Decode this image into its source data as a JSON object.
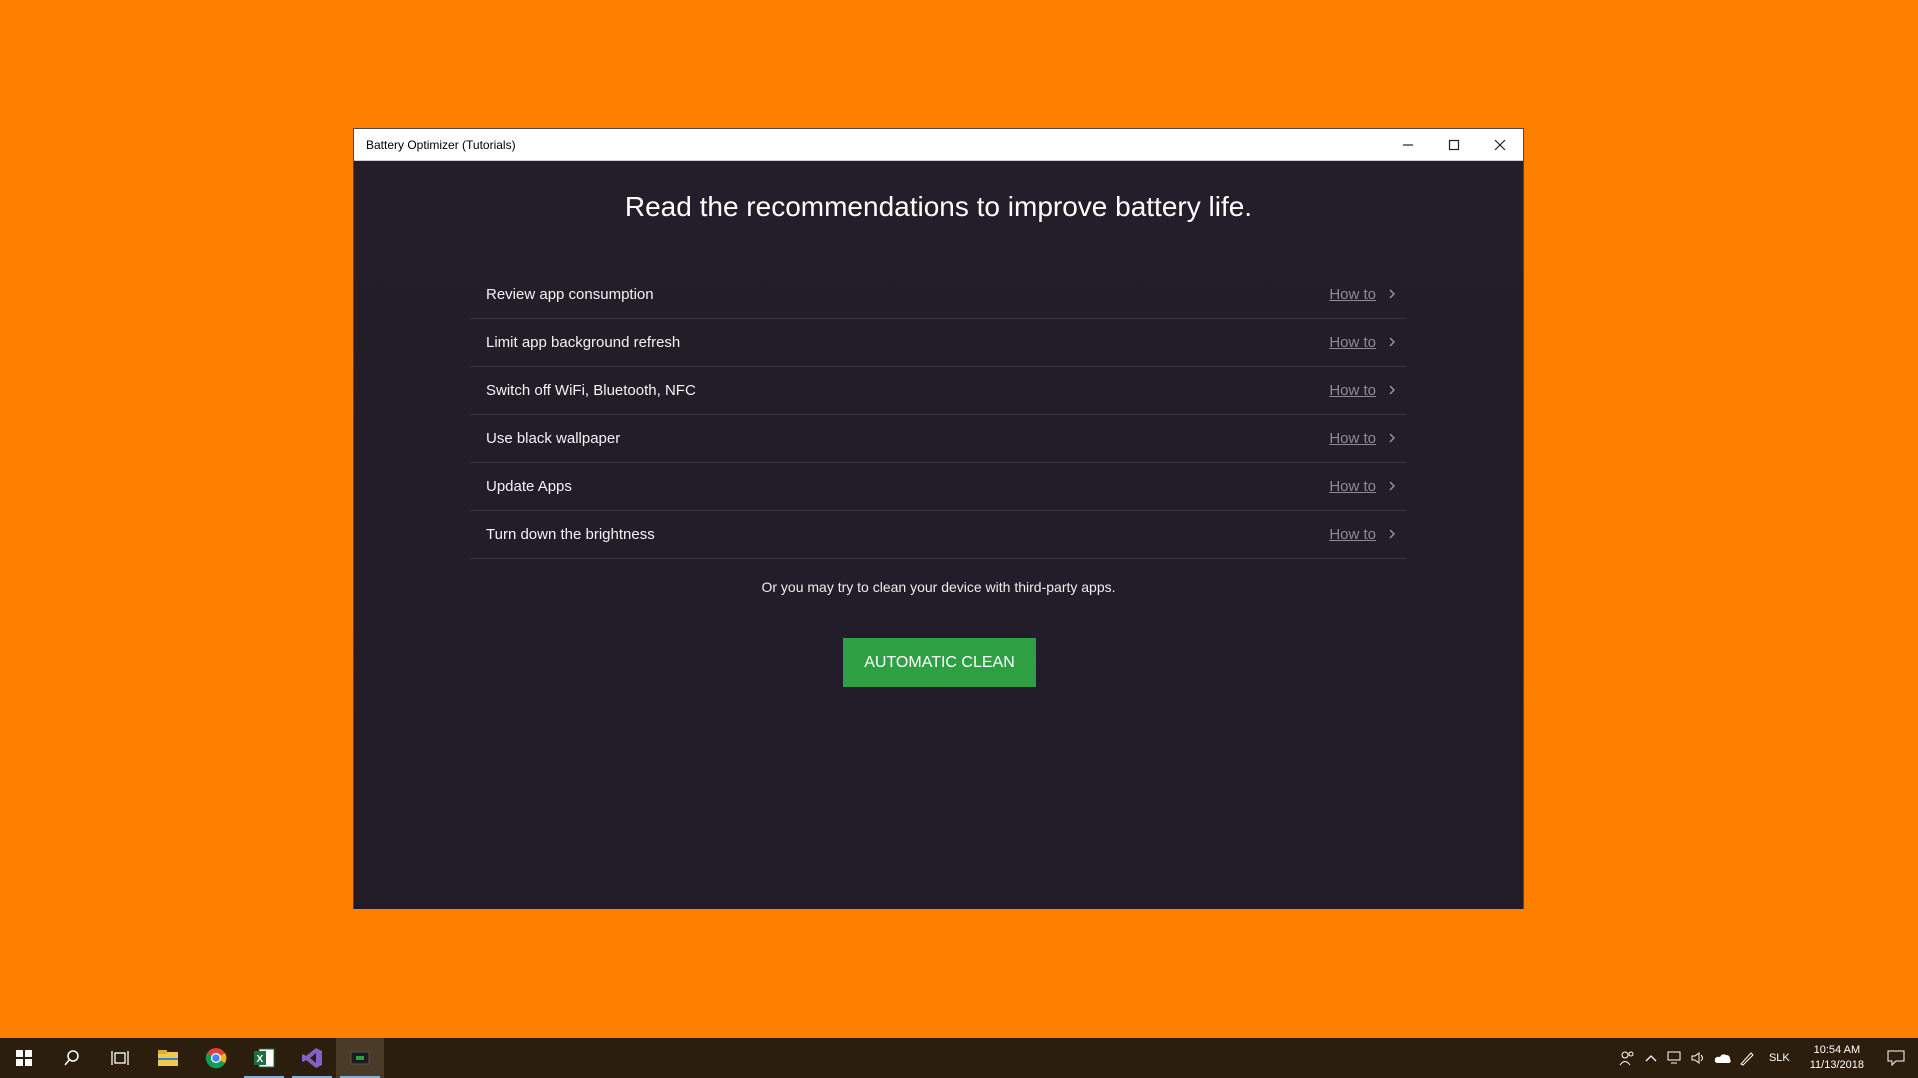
{
  "window": {
    "title": "Battery Optimizer (Tutorials)",
    "controls": [
      "minimize",
      "maximize",
      "close"
    ]
  },
  "main": {
    "heading": "Read the recommendations to improve battery life.",
    "recommendations": [
      {
        "label": "Review app consumption",
        "link": "How to"
      },
      {
        "label": "Limit app background refresh",
        "link": "How to"
      },
      {
        "label": "Switch off WiFi, Bluetooth, NFC",
        "link": "How to"
      },
      {
        "label": "Use black wallpaper",
        "link": "How to"
      },
      {
        "label": "Update Apps",
        "link": "How to"
      },
      {
        "label": "Turn down the brightness",
        "link": "How to"
      }
    ],
    "note": "Or you may try to clean your device with third-party apps.",
    "clean_button": "AUTOMATIC CLEAN"
  },
  "taskbar": {
    "apps": [
      "start-icon",
      "search-icon",
      "task-view-icon",
      "file-explorer-icon",
      "chrome-icon",
      "excel-icon",
      "visual-studio-icon",
      "battery-optimizer-icon"
    ],
    "language": "SLK",
    "time": "10:54 AM",
    "date": "11/13/2018"
  },
  "colors": {
    "desktop": "#ff8000",
    "app_background": "#231e29",
    "accent_button": "#2ea043",
    "taskbar": "#2b1e0d"
  }
}
